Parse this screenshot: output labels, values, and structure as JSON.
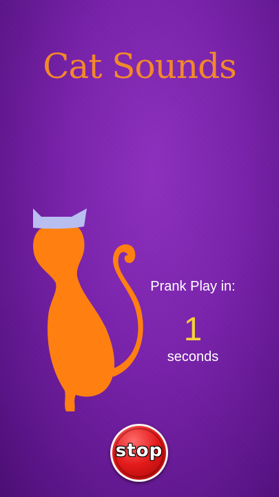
{
  "app": {
    "title": "Cat Sounds"
  },
  "countdown": {
    "label": "Prank Play in:",
    "value": "1",
    "unit": "seconds"
  },
  "controls": {
    "stop_label": "stop"
  },
  "illustration": {
    "icon": "cat-silhouette-icon"
  },
  "colors": {
    "title": "#f2892a",
    "cat": "#ff8010",
    "cat_ears": "#b9bef0",
    "countdown_value": "#f4d23a",
    "stop_button": "#e31a1a",
    "background": "#7a22ad"
  }
}
